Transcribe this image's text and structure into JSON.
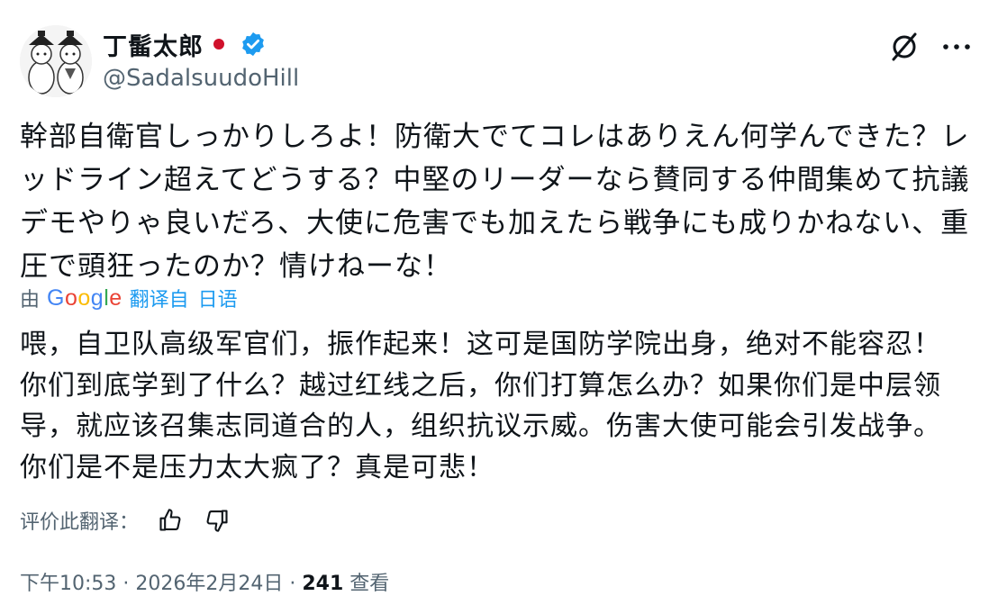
{
  "user": {
    "display_name": "丁髷太郎",
    "handle": "@SadalsuudoHill",
    "verified": true,
    "flag": "japan-flag"
  },
  "tweet": {
    "text": "幹部自衛官しっかりしろよ！防衛大でてコレはありえん何学んできた？レ\nッドライン超えてどうする？中堅のリーダーなら賛同する仲間集めて抗議\nデモやりゃ良いだろ、大使に危害でも加えたら戦争にも成りかねない、重\n圧で頭狂ったのか？情けねーな！"
  },
  "translation": {
    "prefix": "由",
    "provider": "Google",
    "translated_from": "翻译自",
    "language": "日语",
    "text": "喂，自卫队高级军官们，振作起来！这可是国防学院出身，绝对不能容忍！\n你们到底学到了什么？越过红线之后，你们打算怎么办？如果你们是中层领\n导，就应该召集志同道合的人，组织抗议示威。伤害大使可能会引发战争。\n你们是不是压力太大疯了？真是可悲！",
    "rate_label": "评价此翻译："
  },
  "footer": {
    "text": "下午10:53 · 2026年2月24日 · ",
    "views_count": "241",
    "views_label": " 查看"
  },
  "icons": {
    "grok": "grok-icon",
    "more": "more-icon",
    "thumbs_up": "thumbs-up-icon",
    "thumbs_down": "thumbs-down-icon"
  },
  "colors": {
    "accent": "#1d9bf0",
    "muted": "#536471",
    "text": "#0f1419"
  }
}
